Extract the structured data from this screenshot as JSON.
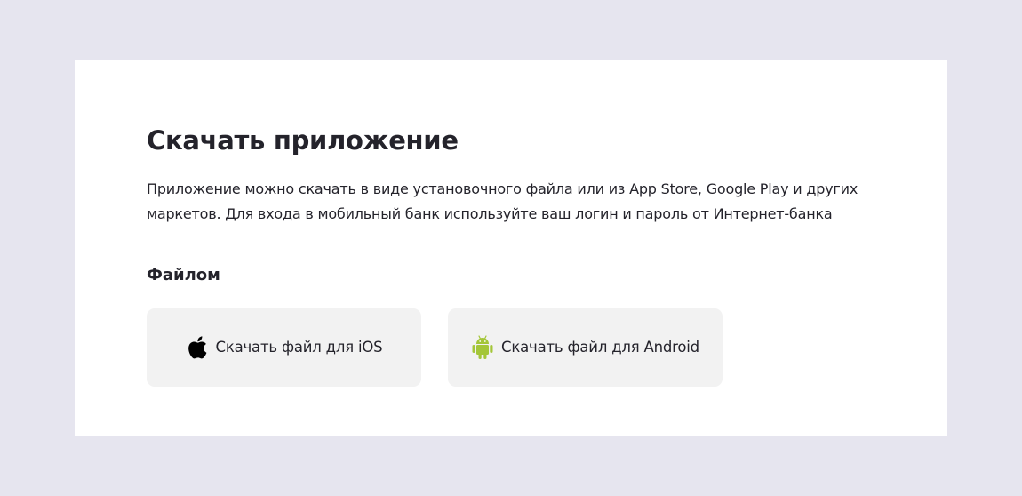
{
  "section": {
    "title": "Скачать приложение",
    "description": "Приложение можно скачать в виде установочного файла или из App Store, Google Play и других маркетов. Для входа в мобильный банк используйте ваш логин и пароль от Интернет-банка",
    "subtitle": "Файлом"
  },
  "downloads": [
    {
      "label": "Скачать файл для iOS",
      "icon": "apple-icon",
      "icon_color": "#000000"
    },
    {
      "label": "Скачать файл для Android",
      "icon": "android-icon",
      "icon_color": "#a4c639"
    }
  ],
  "colors": {
    "page_background": "#e6e5ef",
    "card_background": "#ffffff",
    "button_background": "#f2f2f2",
    "text": "#24232b"
  }
}
